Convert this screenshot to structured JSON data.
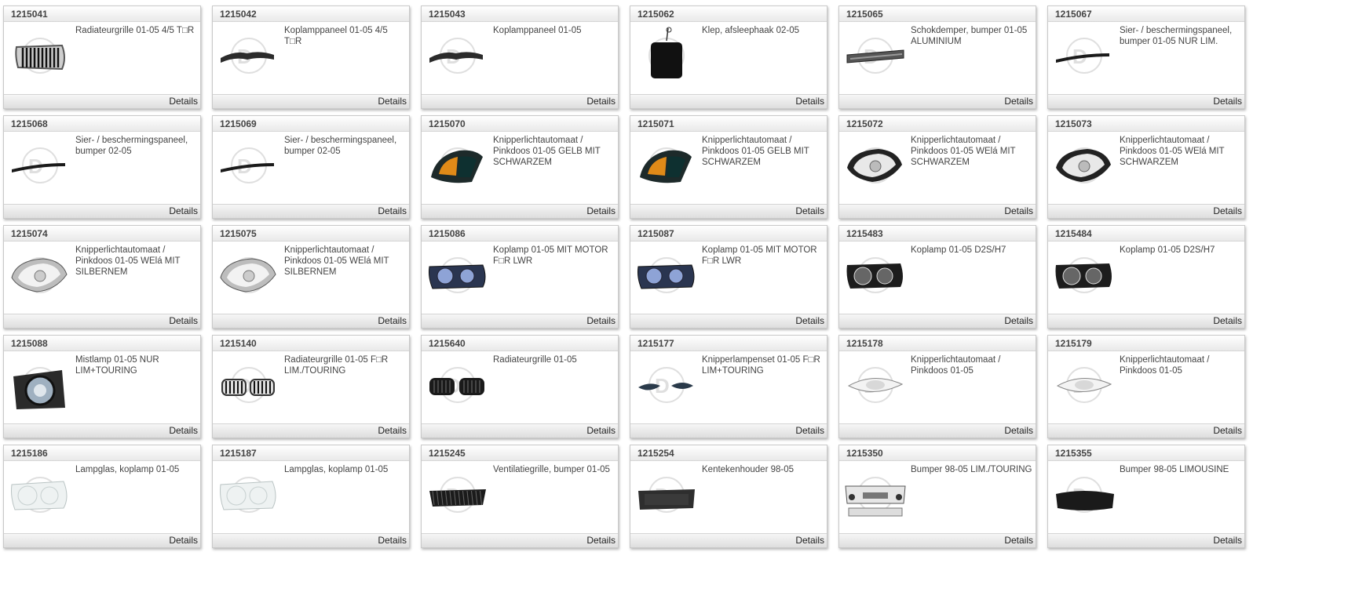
{
  "catalog": {
    "details_label": "Details",
    "products": [
      {
        "number": "1215041",
        "description": "Radiateurgrille 01-05 4/5 T□R",
        "icon": "radiator-grille-chrome-icon"
      },
      {
        "number": "1215042",
        "description": "Koplamppaneel 01-05 4/5 T□R",
        "icon": "headlamp-panel-icon"
      },
      {
        "number": "1215043",
        "description": "Koplamppaneel 01-05",
        "icon": "headlamp-panel-icon"
      },
      {
        "number": "1215062",
        "description": "Klep, afsleephaak 02-05",
        "icon": "tow-hook-cover-icon"
      },
      {
        "number": "1215065",
        "description": "Schokdemper, bumper 01-05 ALUMINIUM",
        "icon": "bumper-absorber-icon"
      },
      {
        "number": "1215067",
        "description": "Sier- / beschermingspaneel, bumper 01-05 NUR LIM.",
        "icon": "trim-strip-icon"
      },
      {
        "number": "1215068",
        "description": "Sier- / beschermingspaneel, bumper 02-05",
        "icon": "trim-strip-icon"
      },
      {
        "number": "1215069",
        "description": "Sier- / beschermingspaneel, bumper 02-05",
        "icon": "trim-strip-icon"
      },
      {
        "number": "1215070",
        "description": "Knipperlichtautomaat / Pinkdoos 01-05 GELB MIT SCHWARZEM",
        "icon": "indicator-amber-icon"
      },
      {
        "number": "1215071",
        "description": "Knipperlichtautomaat / Pinkdoos 01-05 GELB MIT SCHWARZEM",
        "icon": "indicator-amber-icon"
      },
      {
        "number": "1215072",
        "description": "Knipperlichtautomaat / Pinkdoos 01-05 WElá MIT SCHWARZEM",
        "icon": "indicator-clear-black-icon"
      },
      {
        "number": "1215073",
        "description": "Knipperlichtautomaat / Pinkdoos 01-05 WElá MIT SCHWARZEM",
        "icon": "indicator-clear-black-icon"
      },
      {
        "number": "1215074",
        "description": "Knipperlichtautomaat / Pinkdoos 01-05 WElá MIT SILBERNEM",
        "icon": "indicator-clear-silver-icon"
      },
      {
        "number": "1215075",
        "description": "Knipperlichtautomaat / Pinkdoos 01-05 WElá MIT SILBERNEM",
        "icon": "indicator-clear-silver-icon"
      },
      {
        "number": "1215086",
        "description": "Koplamp 01-05 MIT MOTOR F□R LWR",
        "icon": "headlamp-blue-icon"
      },
      {
        "number": "1215087",
        "description": "Koplamp 01-05 MIT MOTOR F□R LWR",
        "icon": "headlamp-blue-icon"
      },
      {
        "number": "1215483",
        "description": "Koplamp 01-05 D2S/H7",
        "icon": "headlamp-dark-icon"
      },
      {
        "number": "1215484",
        "description": "Koplamp 01-05 D2S/H7",
        "icon": "headlamp-dark-icon"
      },
      {
        "number": "1215088",
        "description": "Mistlamp 01-05 NUR LIM+TOURING",
        "icon": "fog-lamp-icon"
      },
      {
        "number": "1215140",
        "description": "Radiateurgrille 01-05 F□R LIM./TOURING",
        "icon": "kidney-grille-chrome-icon"
      },
      {
        "number": "1215640",
        "description": "Radiateurgrille 01-05",
        "icon": "kidney-grille-black-icon"
      },
      {
        "number": "1215177",
        "description": "Knipperlampenset 01-05 F□R LIM+TOURING",
        "icon": "side-marker-pair-icon"
      },
      {
        "number": "1215178",
        "description": "Knipperlichtautomaat / Pinkdoos 01-05",
        "icon": "side-marker-clear-icon"
      },
      {
        "number": "1215179",
        "description": "Knipperlichtautomaat / Pinkdoos 01-05",
        "icon": "side-marker-clear-icon"
      },
      {
        "number": "1215186",
        "description": "Lampglas, koplamp 01-05",
        "icon": "headlamp-lens-icon"
      },
      {
        "number": "1215187",
        "description": "Lampglas, koplamp 01-05",
        "icon": "headlamp-lens-icon"
      },
      {
        "number": "1215245",
        "description": "Ventilatiegrille, bumper 01-05",
        "icon": "mesh-grille-icon"
      },
      {
        "number": "1215254",
        "description": "Kentekenhouder 98-05",
        "icon": "license-plate-holder-icon"
      },
      {
        "number": "1215350",
        "description": "Bumper 98-05 LIM./TOURING",
        "icon": "bumper-kit-icon"
      },
      {
        "number": "1215355",
        "description": "Bumper 98-05 LIMOUSINE",
        "icon": "rear-bumper-icon"
      }
    ]
  }
}
